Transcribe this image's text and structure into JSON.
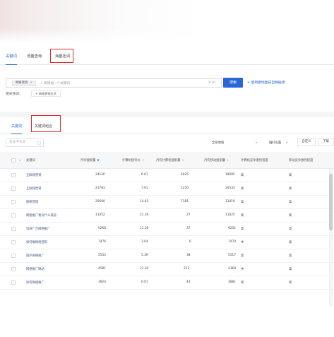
{
  "top_tabs": [
    {
      "label": "关键词"
    },
    {
      "label": "流量查询"
    },
    {
      "label": "海量拓词"
    }
  ],
  "search": {
    "chip": "网络营销",
    "chip_close": "×",
    "placeholder": "+ 再增加一个关键词",
    "count": "1/10",
    "button": "搜索",
    "link": "+ 使用猪地图成自数据源"
  },
  "related": {
    "label": "相关搜词:",
    "button": "+ 网络营销方式"
  },
  "sub_tabs": [
    {
      "label": "关键词"
    },
    {
      "label": "关键词组合"
    }
  ],
  "filters": {
    "search_placeholder": "包含/不包含",
    "search_icon": "□",
    "region": "全部地域",
    "config": "偏好设置",
    "custom": "自定义",
    "download": "下载"
  },
  "table": {
    "headers": [
      "关键词",
      "月均搜索量",
      "计算机指导价",
      "月均计算机搜索量",
      "月均移动搜索量",
      "计算机竞争激烈程度",
      "移动竞争激烈程度"
    ],
    "rows": [
      [
        "互联网营销",
        "24120",
        "6.61",
        "6025",
        "18095",
        "高",
        "高"
      ],
      [
        "互联网营销",
        "21783",
        "7.61",
        "1250",
        "20533",
        "高",
        "高"
      ],
      [
        "网络营销",
        "20600",
        "14.63",
        "7181",
        "13419",
        "高",
        "高"
      ],
      [
        "网络推广要有什么渠道",
        "11052",
        "21.39",
        "27",
        "11025",
        "高",
        "高"
      ],
      [
        "电商广告网络推广",
        "9268",
        "11.36",
        "37",
        "9251",
        "高",
        "高"
      ],
      [
        "如何做网络营销",
        "7476",
        "3.04",
        "6",
        "7470",
        "中",
        "高"
      ],
      [
        "国外网络推广",
        "5555",
        "5.36",
        "38",
        "5517",
        "高",
        "高"
      ],
      [
        "网络推广网站",
        "4581",
        "21.39",
        "213",
        "4368",
        "中",
        "高"
      ],
      [
        "如何网络推广",
        "3924",
        "6.01",
        "43",
        "3881",
        "高",
        "高"
      ]
    ]
  },
  "icons": {
    "sort_down": "▼",
    "sort_both": "⇕",
    "dropdown": "▾"
  }
}
